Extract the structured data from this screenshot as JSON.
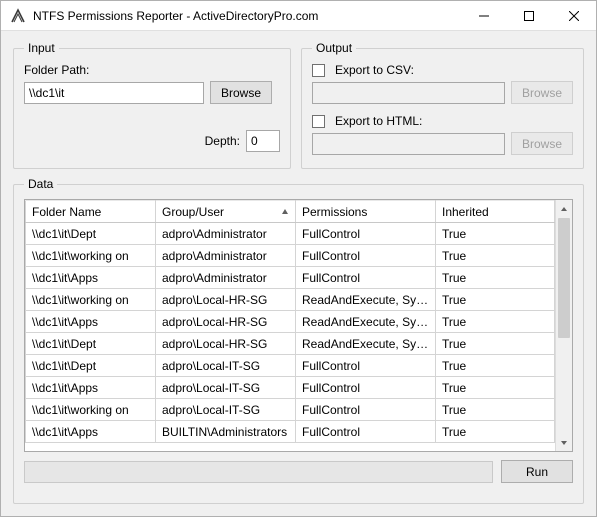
{
  "window": {
    "title": "NTFS Permissions Reporter - ActiveDirectoryPro.com"
  },
  "input": {
    "legend": "Input",
    "folder_path_label": "Folder Path:",
    "folder_path_value": "\\\\dc1\\it",
    "browse_label": "Browse",
    "depth_label": "Depth:",
    "depth_value": "0"
  },
  "output": {
    "legend": "Output",
    "export_csv_label": "Export to CSV:",
    "csv_path_value": "",
    "csv_browse_label": "Browse",
    "export_html_label": "Export to HTML:",
    "html_path_value": "",
    "html_browse_label": "Browse"
  },
  "data": {
    "legend": "Data",
    "columns": {
      "folder": "Folder Name",
      "group_user": "Group/User",
      "permissions": "Permissions",
      "inherited": "Inherited"
    },
    "rows": [
      {
        "folder": "\\\\dc1\\it\\Dept",
        "group_user": "adpro\\Administrator",
        "permissions": "FullControl",
        "inherited": "True"
      },
      {
        "folder": "\\\\dc1\\it\\working on",
        "group_user": "adpro\\Administrator",
        "permissions": "FullControl",
        "inherited": "True"
      },
      {
        "folder": "\\\\dc1\\it\\Apps",
        "group_user": "adpro\\Administrator",
        "permissions": "FullControl",
        "inherited": "True"
      },
      {
        "folder": "\\\\dc1\\it\\working on",
        "group_user": "adpro\\Local-HR-SG",
        "permissions": "ReadAndExecute, Syn...",
        "inherited": "True"
      },
      {
        "folder": "\\\\dc1\\it\\Apps",
        "group_user": "adpro\\Local-HR-SG",
        "permissions": "ReadAndExecute, Syn...",
        "inherited": "True"
      },
      {
        "folder": "\\\\dc1\\it\\Dept",
        "group_user": "adpro\\Local-HR-SG",
        "permissions": "ReadAndExecute, Syn...",
        "inherited": "True"
      },
      {
        "folder": "\\\\dc1\\it\\Dept",
        "group_user": "adpro\\Local-IT-SG",
        "permissions": "FullControl",
        "inherited": "True"
      },
      {
        "folder": "\\\\dc1\\it\\Apps",
        "group_user": "adpro\\Local-IT-SG",
        "permissions": "FullControl",
        "inherited": "True"
      },
      {
        "folder": "\\\\dc1\\it\\working on",
        "group_user": "adpro\\Local-IT-SG",
        "permissions": "FullControl",
        "inherited": "True"
      },
      {
        "folder": "\\\\dc1\\it\\Apps",
        "group_user": "BUILTIN\\Administrators",
        "permissions": "FullControl",
        "inherited": "True"
      }
    ],
    "run_label": "Run"
  }
}
